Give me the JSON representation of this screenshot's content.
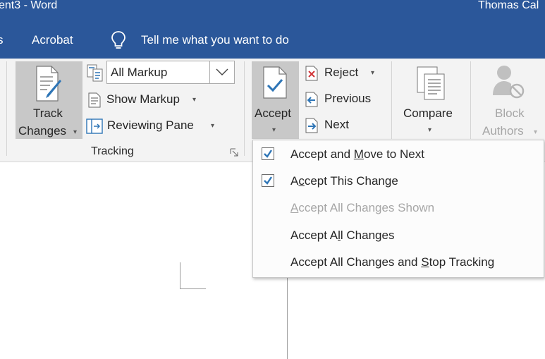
{
  "titlebar": {
    "doc_title": "ent3  -  Word",
    "user": "Thomas Cal"
  },
  "menubar": {
    "prev_tab": "s",
    "acrobat": "Acrobat",
    "tell_me": "Tell me what you want to do"
  },
  "ribbon": {
    "tracking": {
      "track_line1": "Track",
      "track_line2": "Changes",
      "markup_value": "All Markup",
      "show_markup": "Show Markup",
      "reviewing_pane": "Reviewing Pane",
      "group_label": "Tracking"
    },
    "changes": {
      "accept": "Accept",
      "reject": "Reject",
      "previous": "Previous",
      "next": "Next"
    },
    "compare": {
      "label": "Compare"
    },
    "protect": {
      "block_line1": "Block",
      "block_line2": "Authors"
    }
  },
  "accept_menu": {
    "item1": {
      "before": "Accept and ",
      "key": "M",
      "after": "ove to Next"
    },
    "item2": {
      "before": "A",
      "key": "c",
      "after": "cept This Change"
    },
    "item3": {
      "before": "",
      "key": "A",
      "after": "ccept All Changes Shown"
    },
    "item4": {
      "before": "Accept A",
      "key": "l",
      "after": "l Changes"
    },
    "item5": {
      "before": "Accept All Changes and ",
      "key": "S",
      "after": "top Tracking"
    }
  },
  "colors": {
    "title_blue": "#2b579a",
    "check_blue": "#2e75b6",
    "ribbon_bg": "#f3f3f3",
    "pressed_gray": "#c8c8c8"
  },
  "icons": [
    "lightbulb-icon",
    "track-changes-icon",
    "markup-display-icon",
    "show-markup-icon",
    "reviewing-pane-icon",
    "accept-icon",
    "reject-icon",
    "previous-change-icon",
    "next-change-icon",
    "compare-icon",
    "block-authors-icon",
    "dialog-launcher-icon",
    "checkmark-icon"
  ]
}
